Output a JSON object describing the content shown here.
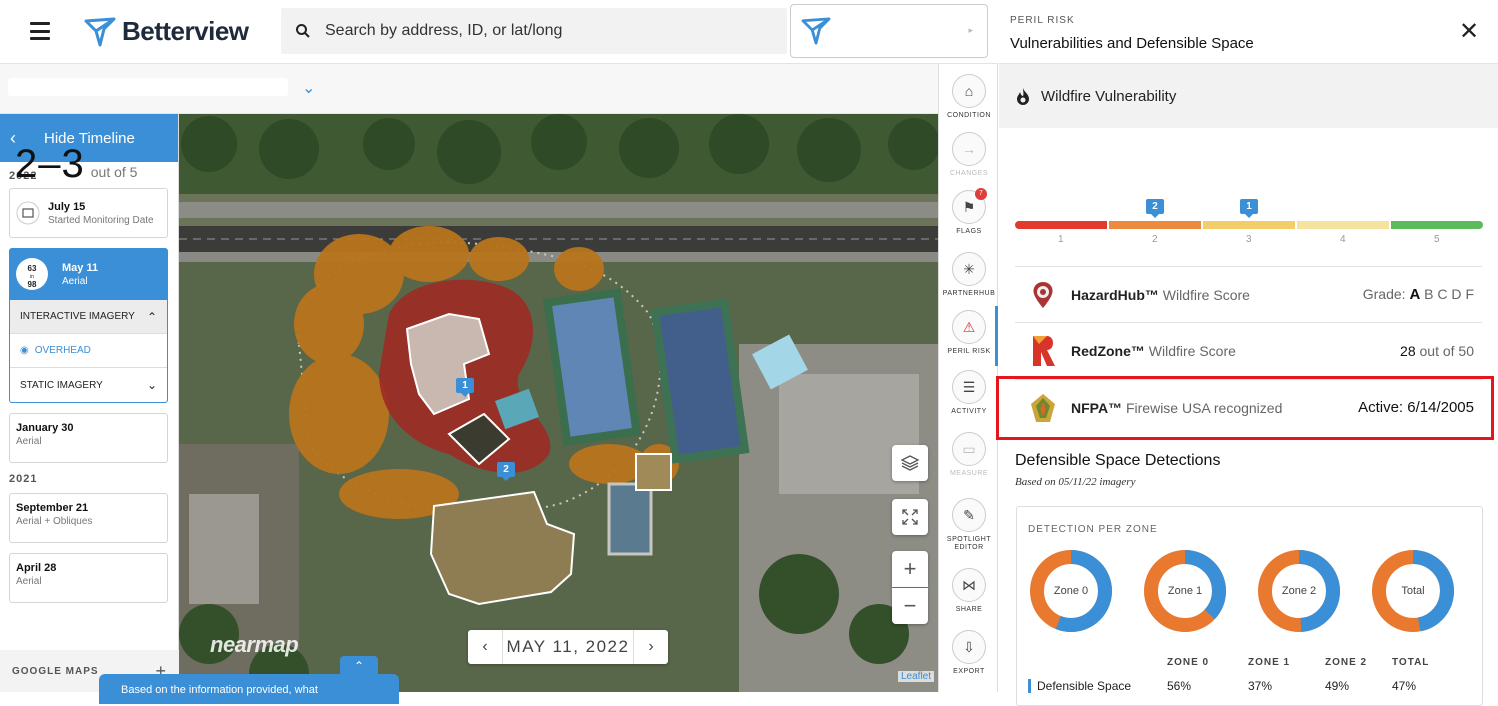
{
  "header": {
    "brand": "Betterview",
    "search_placeholder": "Search by address, ID, or lat/long"
  },
  "timeline": {
    "hide_label": "Hide Timeline",
    "groups": [
      {
        "year": "2022"
      },
      {
        "year": "2021"
      }
    ],
    "items": [
      {
        "date": "July 15",
        "sub": "Started Monitoring Date"
      },
      {
        "date": "May 11",
        "sub": "Aerial",
        "score_top": "63",
        "score_mid": "in",
        "score_bot": "98"
      },
      {
        "date": "January 30",
        "sub": "Aerial"
      },
      {
        "date": "September 21",
        "sub": "Aerial + Obliques"
      },
      {
        "date": "April 28",
        "sub": "Aerial"
      }
    ],
    "interactive_imagery": "INTERACTIVE IMAGERY",
    "overhead": "OVERHEAD",
    "static_imagery": "STATIC IMAGERY",
    "google_maps": "GOOGLE MAPS"
  },
  "map": {
    "date": "MAY 11, 2022",
    "watermark": "nearmap",
    "attribution": "Leaflet",
    "toast": "Based on the information provided, what",
    "markers": [
      "1",
      "2"
    ]
  },
  "tools": [
    {
      "label": "CONDITION",
      "icon": "house-icon"
    },
    {
      "label": "CHANGES",
      "icon": "arrow-right-icon"
    },
    {
      "label": "FLAGS",
      "icon": "flag-icon",
      "badge": "7"
    },
    {
      "label": "PARTNERHUB",
      "icon": "hub-icon"
    },
    {
      "label": "PERIL RISK",
      "icon": "warning-icon"
    },
    {
      "label": "ACTIVITY",
      "icon": "list-icon"
    },
    {
      "label": "MEASURE",
      "icon": "ruler-icon"
    },
    {
      "label": "SPOTLIGHT EDITOR",
      "icon": "spotlight-icon"
    },
    {
      "label": "SHARE",
      "icon": "share-icon"
    },
    {
      "label": "EXPORT",
      "icon": "export-icon"
    }
  ],
  "panel": {
    "kicker": "PERIL RISK",
    "title": "Vulnerabilities and Defensible Space",
    "section": "Wildfire Vulnerability",
    "score": "2–3",
    "score_suffix": "out of 5",
    "scale_labels": [
      "1",
      "2",
      "3",
      "4",
      "5"
    ],
    "scale_colors": [
      "#e23b2e",
      "#ec8a3d",
      "#f3cd6a",
      "#f5e4a0",
      "#5bbb5a"
    ],
    "scale_markers": [
      "2",
      "1"
    ],
    "providers": [
      {
        "name": "HazardHub™",
        "desc": "Wildfire Score",
        "right_label": "Grade:",
        "grades": [
          "A",
          "B",
          "C",
          "D",
          "F"
        ],
        "selected_grade": "A"
      },
      {
        "name": "RedZone™",
        "desc": "Wildfire Score",
        "right_value": "28",
        "right_suffix": "out of 50"
      },
      {
        "name": "NFPA™",
        "desc": "Firewise USA recognized",
        "right_value": "Active: 6/14/2005"
      }
    ],
    "defensible_title": "Defensible Space Detections",
    "defensible_sub": "Based on 05/11/22 imagery",
    "detection_label": "DETECTION PER ZONE",
    "zones": [
      "Zone 0",
      "Zone 1",
      "Zone 2",
      "Total"
    ],
    "zone_fill_fraction": [
      0.56,
      0.37,
      0.49,
      0.47
    ],
    "colors": {
      "accent": "#3a8fd6",
      "orange": "#e8792f",
      "highlight": "#e3171d"
    },
    "columns": [
      "ZONE 0",
      "ZONE 1",
      "ZONE 2",
      "TOTAL"
    ],
    "row_label": "Defensible Space",
    "row_values": [
      "56%",
      "37%",
      "49%",
      "47%"
    ]
  }
}
